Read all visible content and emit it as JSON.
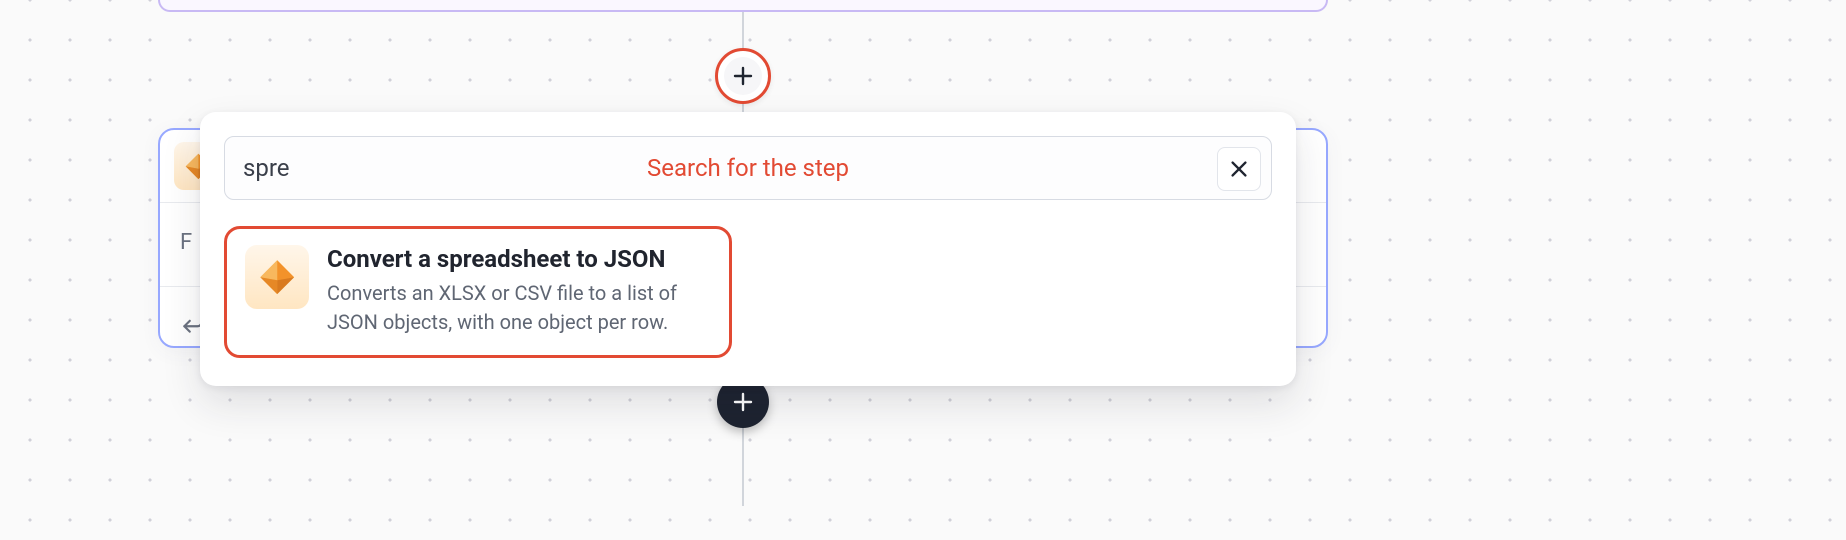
{
  "colors": {
    "highlight": "#e24a33",
    "card_border": "#97a8ff",
    "top_card_border": "#c8b9f4"
  },
  "search": {
    "value": "spre",
    "hint": "Search for the step"
  },
  "result": {
    "title": "Convert a spreadsheet to JSON",
    "description": "Converts an XLSX or CSV file to a list of JSON objects, with one object per row."
  },
  "step_card": {
    "peek_left_letter": "F"
  },
  "icons": {
    "plus": "plus-icon",
    "close": "close-icon",
    "more": "more-vertical-icon",
    "spreadsheet": "spreadsheet-octahedron-icon",
    "reply": "reply-arrow-icon"
  }
}
